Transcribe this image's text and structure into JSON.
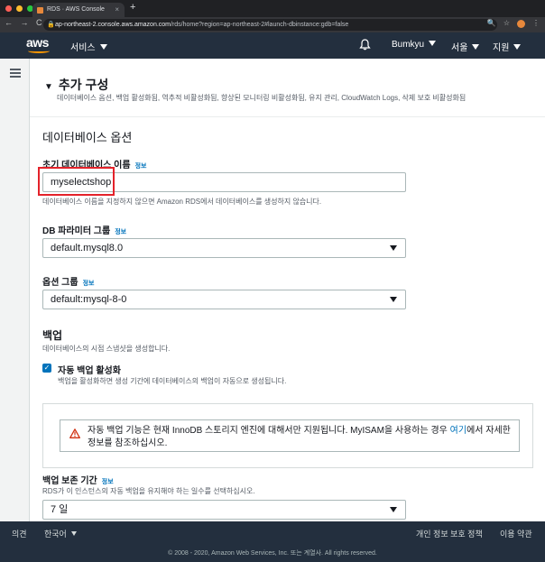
{
  "browser": {
    "tab_title": "RDS · AWS Console",
    "tab_close": "×",
    "new_tab": "+",
    "nav_buttons": "← → C",
    "url_host": "ap-northeast-2.console.aws.amazon.com",
    "url_path": "/rds/home?region=ap-northeast-2#launch-dbinstance:gdb=false",
    "window_controls_colors": [
      "#ff5f57",
      "#febc2e",
      "#28c840"
    ]
  },
  "header": {
    "logo": "aws",
    "services": "서비스",
    "user": "Bumkyu",
    "region": "서울",
    "support": "지원"
  },
  "section": {
    "title": "추가 구성",
    "subtitle": "데이터베이스 옵션, 백업 활성화됨, 역추적 비활성화됨, 향상된 모니터링 비활성화됨, 유지 관리, CloudWatch Logs, 삭제 보호 비활성화됨"
  },
  "db_options": {
    "heading": "데이터베이스 옵션",
    "initial_db_label": "초기 데이터베이스 이름",
    "info": "정보",
    "initial_db_value": "myselectshop",
    "initial_db_hint": "데이터베이스 이름을 지정하지 않으면 Amazon RDS에서 데이터베이스를 생성하지 않습니다.",
    "param_group_label": "DB 파라미터 그룹",
    "param_group_value": "default.mysql8.0",
    "option_group_label": "옵션 그룹",
    "option_group_value": "default:mysql-8-0"
  },
  "backup": {
    "heading": "백업",
    "hint": "데이터베이스의 시점 스냅샷을 생성합니다.",
    "auto_backup_label": "자동 백업 활성화",
    "auto_backup_checked": true,
    "auto_backup_hint": "백업을 활성화하면 생성 기간에 데이터베이스의 백업이 자동으로 생성됩니다.",
    "warning_pre": "자동 백업 기능은 현재 InnoDB 스토리지 엔진에 대해서만 지원됩니다. MyISAM을 사용하는 경우 ",
    "warning_link": "여기",
    "warning_post": "에서 자세한 정보를 참조하십시오.",
    "retention_label": "백업 보존 기간",
    "retention_hint": "RDS가 이 인스턴스의 자동 백업을 유지해야 하는 일수를 선택하십시오.",
    "retention_value": "7 일"
  },
  "footer": {
    "feedback": "의견",
    "language": "한국어",
    "privacy": "개인 정보 보호 정책",
    "terms": "이용 약관",
    "copyright": "© 2008 - 2020, Amazon Web Services, Inc. 또는 계열사. All rights reserved."
  },
  "colors": {
    "aws_nav": "#232f3e",
    "aws_orange": "#ff9900",
    "link_blue": "#0073bb",
    "highlight_red": "#e4222a",
    "warning_red": "#d13212"
  }
}
